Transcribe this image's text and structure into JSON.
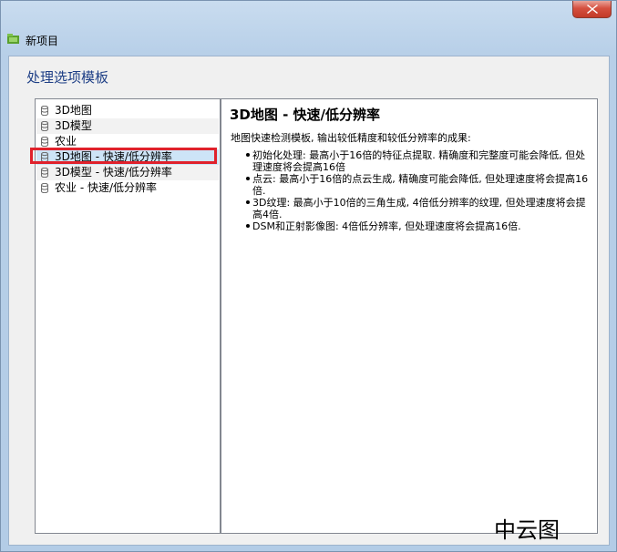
{
  "window": {
    "title": "新项目",
    "close_icon": "close-icon"
  },
  "panel": {
    "heading": "处理选项模板"
  },
  "templates": {
    "items": [
      {
        "label": "3D地图"
      },
      {
        "label": "3D模型"
      },
      {
        "label": "农业"
      },
      {
        "label": "3D地图 - 快速/低分辨率"
      },
      {
        "label": "3D模型 - 快速/低分辨率"
      },
      {
        "label": "农业 - 快速/低分辨率"
      }
    ],
    "selected_index": 3,
    "highlight_color": "#e0212b"
  },
  "details": {
    "title": "3D地图 - 快速/低分辨率",
    "summary": "地图快速检测模板, 输出较低精度和较低分辨率的成果:",
    "bullets": [
      "初始化处理: 最高小于16倍的特征点提取. 精确度和完整度可能会降低, 但处理速度将会提高16倍",
      "点云: 最高小于16倍的点云生成, 精确度可能会降低, 但处理速度将会提高16倍.",
      "3D纹理: 最高小于10倍的三角生成, 4倍低分辨率的纹理, 但处理速度将会提高4倍.",
      "DSM和正射影像图: 4倍低分辨率, 但处理速度将会提高16倍."
    ]
  },
  "watermark": {
    "text": "中云图"
  }
}
